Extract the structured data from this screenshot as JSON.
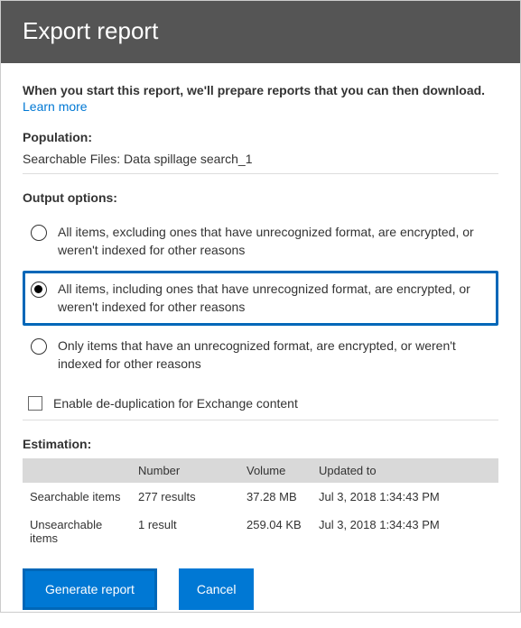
{
  "header": {
    "title": "Export report"
  },
  "intro": {
    "text": "When you start this report, we'll prepare reports that you can then download.",
    "learn_more": "Learn more"
  },
  "population": {
    "label": "Population:",
    "value": "Searchable Files:  Data spillage search_1"
  },
  "output": {
    "label": "Output options:",
    "options": [
      "All items, excluding ones that have unrecognized format, are encrypted, or weren't indexed for other reasons",
      "All items, including ones that have unrecognized format, are encrypted, or weren't indexed for other reasons",
      "Only items that have an unrecognized format, are encrypted, or weren't indexed for other reasons"
    ],
    "dedup_label": "Enable de-duplication for Exchange content"
  },
  "estimation": {
    "label": "Estimation:",
    "columns": [
      "",
      "Number",
      "Volume",
      "Updated to"
    ],
    "rows": [
      {
        "name": "Searchable items",
        "number": "277 results",
        "volume": "37.28 MB",
        "updated": "Jul 3, 2018 1:34:43 PM"
      },
      {
        "name": "Unsearchable items",
        "number": "1 result",
        "volume": "259.04 KB",
        "updated": "Jul 3, 2018 1:34:43 PM"
      }
    ]
  },
  "footer": {
    "generate": "Generate report",
    "cancel": "Cancel"
  }
}
